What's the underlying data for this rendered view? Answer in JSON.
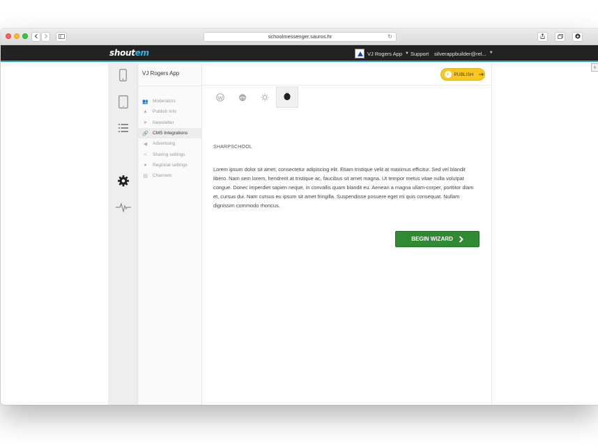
{
  "browser": {
    "url": "schoolmessenger.sauros.hr"
  },
  "topbar": {
    "logo_main": "shout",
    "logo_accent": "em",
    "app_selector": "VJ Rogers App",
    "support": "Support",
    "user": "silverappbuilder@rel..."
  },
  "submenu": {
    "app_name": "VJ Rogers App",
    "items": [
      {
        "label": "Moderators",
        "icon": "moderators-icon"
      },
      {
        "label": "Publish Info",
        "icon": "publish-info-icon"
      },
      {
        "label": "Newsletter",
        "icon": "newsletter-icon"
      },
      {
        "label": "CMS Integrations",
        "icon": "link-icon"
      },
      {
        "label": "Advertising",
        "icon": "megaphone-icon"
      },
      {
        "label": "Sharing settings",
        "icon": "share-icon"
      },
      {
        "label": "Regional settings",
        "icon": "globe-icon"
      },
      {
        "label": "Channels",
        "icon": "channels-icon"
      }
    ]
  },
  "main": {
    "publish_label": "PUBLISH",
    "section_title": "SHARPSCHOOL",
    "description": "Lorem ipsum dolor sit amet, consectetur adipiscing elit. Etiam tristique velit at maximus efficitur. Sed vel blandit libero. Nam sem lorem, hendrerit at tristique ac, faucibus sit amet magna. Ut tempor metus vitae nulla volutpat congue. Donec imperdiet sapien neque, in convallis quam blandit eu. Aenean a magna ullam-corper, porttitor diam et, cursus dui. Nam cursus eu ipsum sit amet fringilla. Suspendisse posuere eget mi quis consequat. Nullam dignissim commodo rhoncus.",
    "wizard_label": "BEGIN WIZARD"
  },
  "colors": {
    "topbar": "#222222",
    "accent_blue": "#2aa0c8",
    "publish_yellow": "#f8c81c",
    "wizard_green": "#2f8a33"
  }
}
